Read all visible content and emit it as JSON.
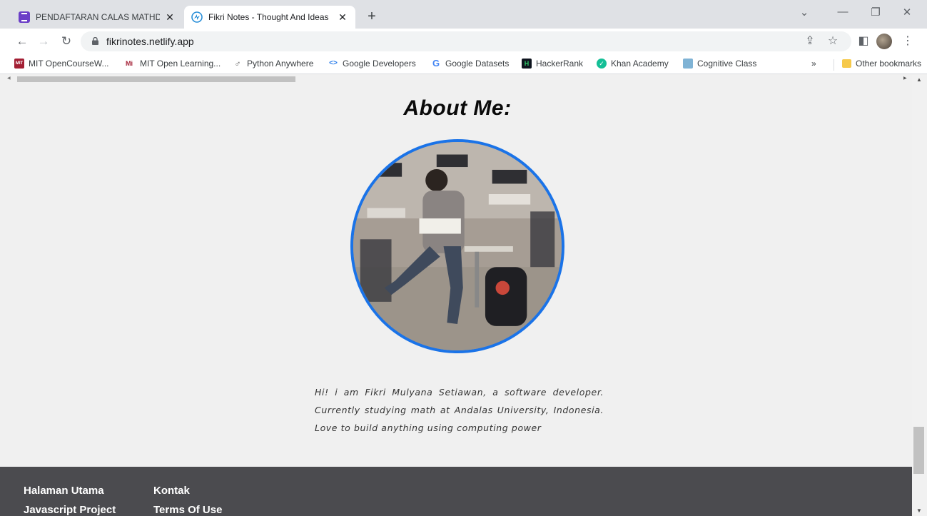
{
  "browser": {
    "tabs": [
      {
        "title": "PENDAFTARAN CALAS MATHDA",
        "icon": "google-forms-icon",
        "active": false
      },
      {
        "title": "Fikri Notes - Thought And Ideas",
        "icon": "netlify-icon",
        "active": true
      }
    ],
    "new_tab": "+",
    "url": "fikrinotes.netlify.app",
    "bookmarks": [
      {
        "label": "MIT OpenCourseW...",
        "icon": "mit-ocw-icon"
      },
      {
        "label": "MIT Open Learning...",
        "icon": "mit-icon"
      },
      {
        "label": "Python Anywhere",
        "icon": "python-anywhere-icon"
      },
      {
        "label": "Google Developers",
        "icon": "google-developers-icon"
      },
      {
        "label": "Google Datasets",
        "icon": "google-icon"
      },
      {
        "label": "HackerRank",
        "icon": "hackerrank-icon"
      },
      {
        "label": "Khan Academy",
        "icon": "khan-academy-icon"
      },
      {
        "label": "Cognitive Class",
        "icon": "cognitive-class-icon"
      }
    ],
    "bookmarks_overflow": "»",
    "other_bookmarks": "Other bookmarks"
  },
  "page": {
    "about_title": "About Me:",
    "bio": "Hi! i am Fikri Mulyana Setiawan, a software developer. Currently studying math at Andalas University, Indonesia. Love to build anything using computing power",
    "footer": {
      "col1": [
        "Halaman Utama",
        "Javascript Project"
      ],
      "col2": [
        "Kontak",
        "Terms Of Use"
      ]
    }
  },
  "colors": {
    "accent_ring": "#1a73e8",
    "footer_bg": "#4b4b4f",
    "page_bg": "#f0f0f0"
  }
}
